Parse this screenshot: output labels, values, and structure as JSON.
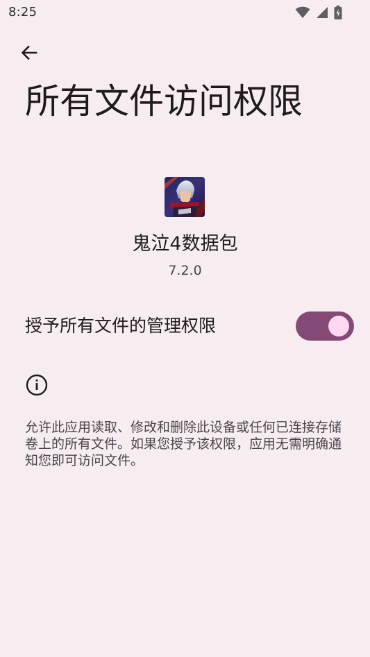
{
  "status_bar": {
    "time": "8:25",
    "icons": [
      "wifi-icon",
      "cellular-signal-icon",
      "battery-charging-icon"
    ]
  },
  "app_bar": {
    "back_icon": "arrow-back-icon"
  },
  "page": {
    "title": "所有文件访问权限"
  },
  "app": {
    "name": "鬼泣4数据包",
    "version": "7.2.0",
    "icon": "game-cover-icon"
  },
  "permission": {
    "label": "授予所有文件的管理权限",
    "enabled": true
  },
  "info": {
    "icon": "info-icon",
    "text": "允许此应用读取、修改和删除此设备或任何已连接存储卷上的所有文件。如果您授予该权限，应用无需明确通知您即可访问文件。"
  },
  "colors": {
    "background": "#f7edf1",
    "switch_track": "#844a76",
    "switch_thumb": "#ffd7f1",
    "text_primary": "#1d1b1f",
    "text_secondary": "#49454e"
  }
}
